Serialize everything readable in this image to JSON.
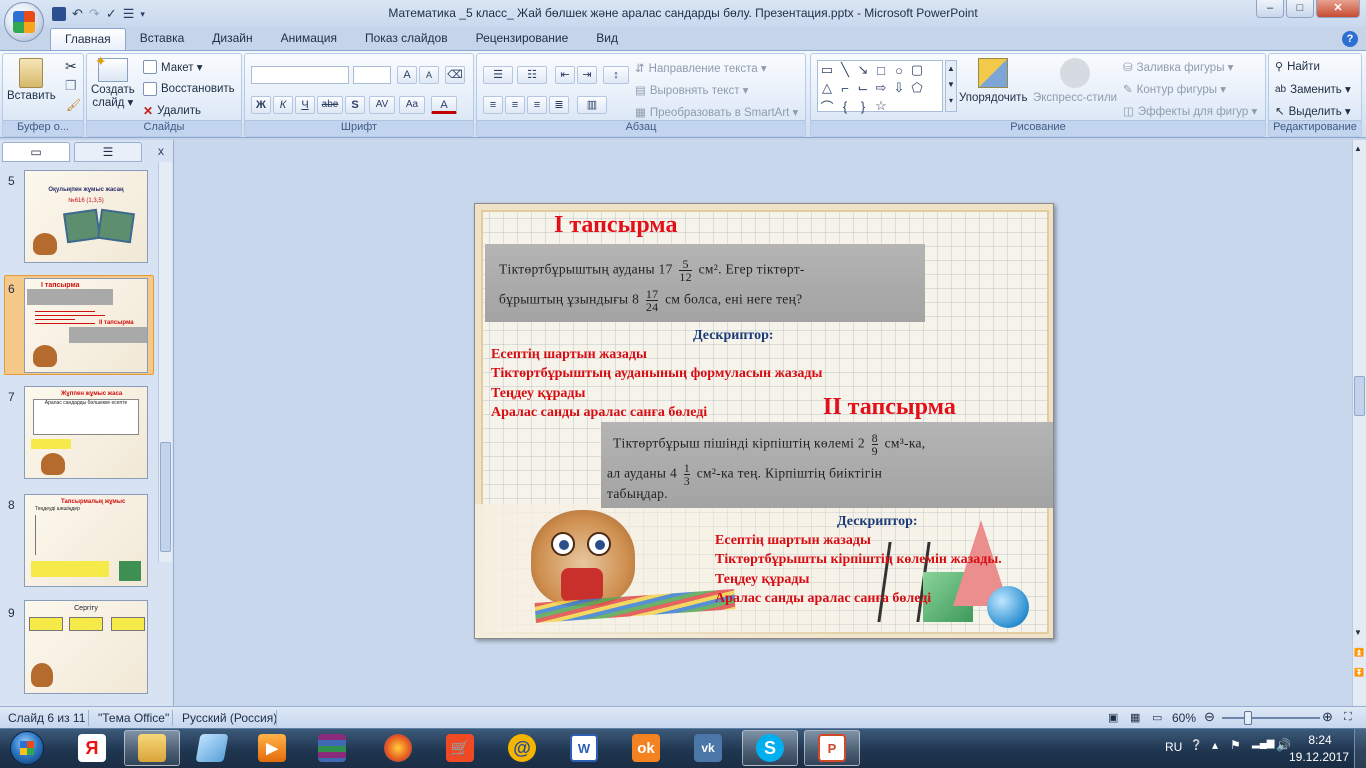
{
  "window": {
    "title": "Математика _5 класс_ Жай бөлшек және аралас сандарды бөлу. Презентация.pptx - Microsoft PowerPoint",
    "controls": {
      "minimize": "–",
      "maximize": "□",
      "close": "✕"
    }
  },
  "ribbon_tabs": [
    "Главная",
    "Вставка",
    "Дизайн",
    "Анимация",
    "Показ слайдов",
    "Рецензирование",
    "Вид"
  ],
  "ribbon": {
    "clipboard": {
      "label": "Буфер о...",
      "paste": "Вставить"
    },
    "slides": {
      "label": "Слайды",
      "create": "Создать",
      "create2": "слайд ▾",
      "layout": "Макет ▾",
      "reset": "Восстановить",
      "delete": "Удалить"
    },
    "font": {
      "label": "Шрифт",
      "bold": "Ж",
      "italic": "К",
      "underline": "Ч",
      "strike": "abe",
      "shadow": "S",
      "spacing": "AV",
      "case": "Aa",
      "color": "A",
      "grow": "A",
      "shrink": "A"
    },
    "paragraph": {
      "label": "Абзац",
      "text_dir": "Направление текста ▾",
      "align_text": "Выровнять текст ▾",
      "smartart": "Преобразовать в SmartArt ▾"
    },
    "drawing": {
      "label": "Рисование",
      "arrange": "Упорядочить",
      "quick_styles": "Экспресс-стили",
      "fill": "Заливка фигуры ▾",
      "outline": "Контур фигуры ▾",
      "effects": "Эффекты для фигур ▾"
    },
    "editing": {
      "label": "Редактирование",
      "find": "Найти",
      "replace": "Заменить ▾",
      "select": "Выделить ▾"
    }
  },
  "slide_panel": {
    "close": "x",
    "thumbnails": [
      {
        "number": "5",
        "title": "Оқулықпен жұмыс жасаң",
        "subtitle": "№616 (1,3,5)"
      },
      {
        "number": "6",
        "title": "І тапсырма",
        "subtitle": "ІІ тапсырма",
        "selected": true
      },
      {
        "number": "7",
        "title": "Жұппен жұмыс жаса",
        "subtitle": "Аралас сандарды бөлшекке есепте"
      },
      {
        "number": "8",
        "title": "Тапсырмалық жұмыс",
        "subtitle": "Теңдеуді шешіңдер"
      },
      {
        "number": "9",
        "title": "Сергіту",
        "subtitle": ""
      }
    ]
  },
  "slide": {
    "task1_title": "І тапсырма",
    "task1_photo_line1": "Тіктөртбұрыштың ауданы 17",
    "task1_frac1_num": "5",
    "task1_frac1_den": "12",
    "task1_photo_line1_end": "см². Егер тіктөрт-",
    "task1_photo_line2": "бұрыштың ұзындығы 8",
    "task1_frac2_num": "17",
    "task1_frac2_den": "24",
    "task1_photo_line2_end": "см болса, ені неге тең?",
    "descriptor1_head": "Дескриптор:",
    "descriptor1_items": [
      "Есептің шартын жазады",
      "Тіктөртбұрыштың ауданының формуласын жазады",
      "Теңдеу құрады",
      "Аралас санды аралас санға бөледі"
    ],
    "task2_title": "ІІ тапсырма",
    "task2_photo_line1": "Тіктөртбұрыш пішінді кірпіштің көлемі 2",
    "task2_frac1_num": "8",
    "task2_frac1_den": "9",
    "task2_photo_line1_end": "см³-ка,",
    "task2_photo_line2": "ал ауданы 4",
    "task2_frac2_num": "1",
    "task2_frac2_den": "3",
    "task2_photo_line2_end": "см²-ка тең. Кірпіштің биіктігін",
    "task2_photo_line3": "табыңдар.",
    "descriptor2_head": "Дескриптор:",
    "descriptor2_items": [
      "Есептің шартын жазады",
      "Тіктөртбұрышты кірпіштің көлемін жазады.",
      "Теңдеу құрады",
      "Аралас санды аралас санға бөледі"
    ]
  },
  "status_bar": {
    "slide": "Слайд 6 из 11",
    "theme": "\"Тема Office\"",
    "language": "Русский (Россия)",
    "zoom": "60%"
  },
  "taskbar": {
    "apps": [
      "folder",
      "notepad",
      "media-player",
      "winrar",
      "firefox",
      "yandex-market",
      "email",
      "word",
      "odnoklassniki",
      "vk",
      "skype",
      "powerpoint"
    ],
    "tray": {
      "lang": "RU",
      "time": "8:24",
      "date": "19.12.2017"
    }
  }
}
